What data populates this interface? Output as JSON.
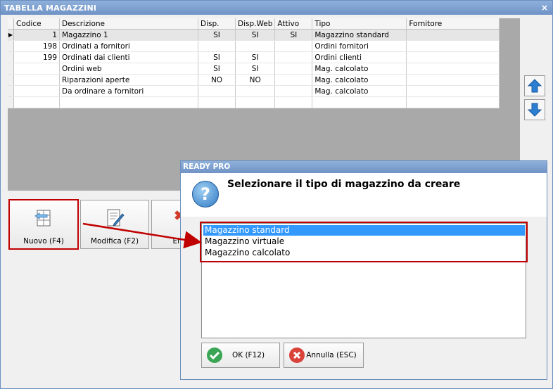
{
  "window": {
    "title": "TABELLA MAGAZZINI",
    "close": "×"
  },
  "grid": {
    "columns": [
      "Codice",
      "Descrizione",
      "Disp.",
      "Disp.Web",
      "Attivo",
      "Tipo",
      "Fornitore"
    ],
    "rows": [
      [
        "1",
        "Magazzino 1",
        "SI",
        "SI",
        "SI",
        "Magazzino standard",
        ""
      ],
      [
        "198",
        "Ordinati a fornitori",
        "",
        "",
        "",
        "Ordini fornitori",
        ""
      ],
      [
        "199",
        "Ordinati dai clienti",
        "SI",
        "SI",
        "",
        "Ordini clienti",
        ""
      ],
      [
        "",
        "Ordini web",
        "SI",
        "SI",
        "",
        "Mag. calcolato",
        ""
      ],
      [
        "",
        "Riparazioni aperte",
        "NO",
        "NO",
        "",
        "Mag. calcolato",
        ""
      ],
      [
        "",
        "Da ordinare a fornitori",
        "",
        "",
        "",
        "Mag. calcolato",
        ""
      ],
      [
        "",
        "",
        "",
        "",
        "",
        "",
        ""
      ]
    ],
    "current_row_marker": "▶"
  },
  "toolbar": {
    "new_label": "Nuovo (F4)",
    "edit_label": "Modifica (F2)",
    "delete_label_partial": "Eli"
  },
  "dialog": {
    "title": "READY PRO",
    "question_mark": "?",
    "heading": "Selezionare il tipo di magazzino da creare",
    "options": [
      "Magazzino standard",
      "Magazzino virtuale",
      "Magazzino calcolato"
    ],
    "selected_index": 0,
    "ok_label": "OK (F12)",
    "cancel_label": "Annulla (ESC)"
  },
  "colors": {
    "highlight": "#c00000",
    "selection": "#3399ff",
    "titlebar": "#7a9ccd"
  }
}
